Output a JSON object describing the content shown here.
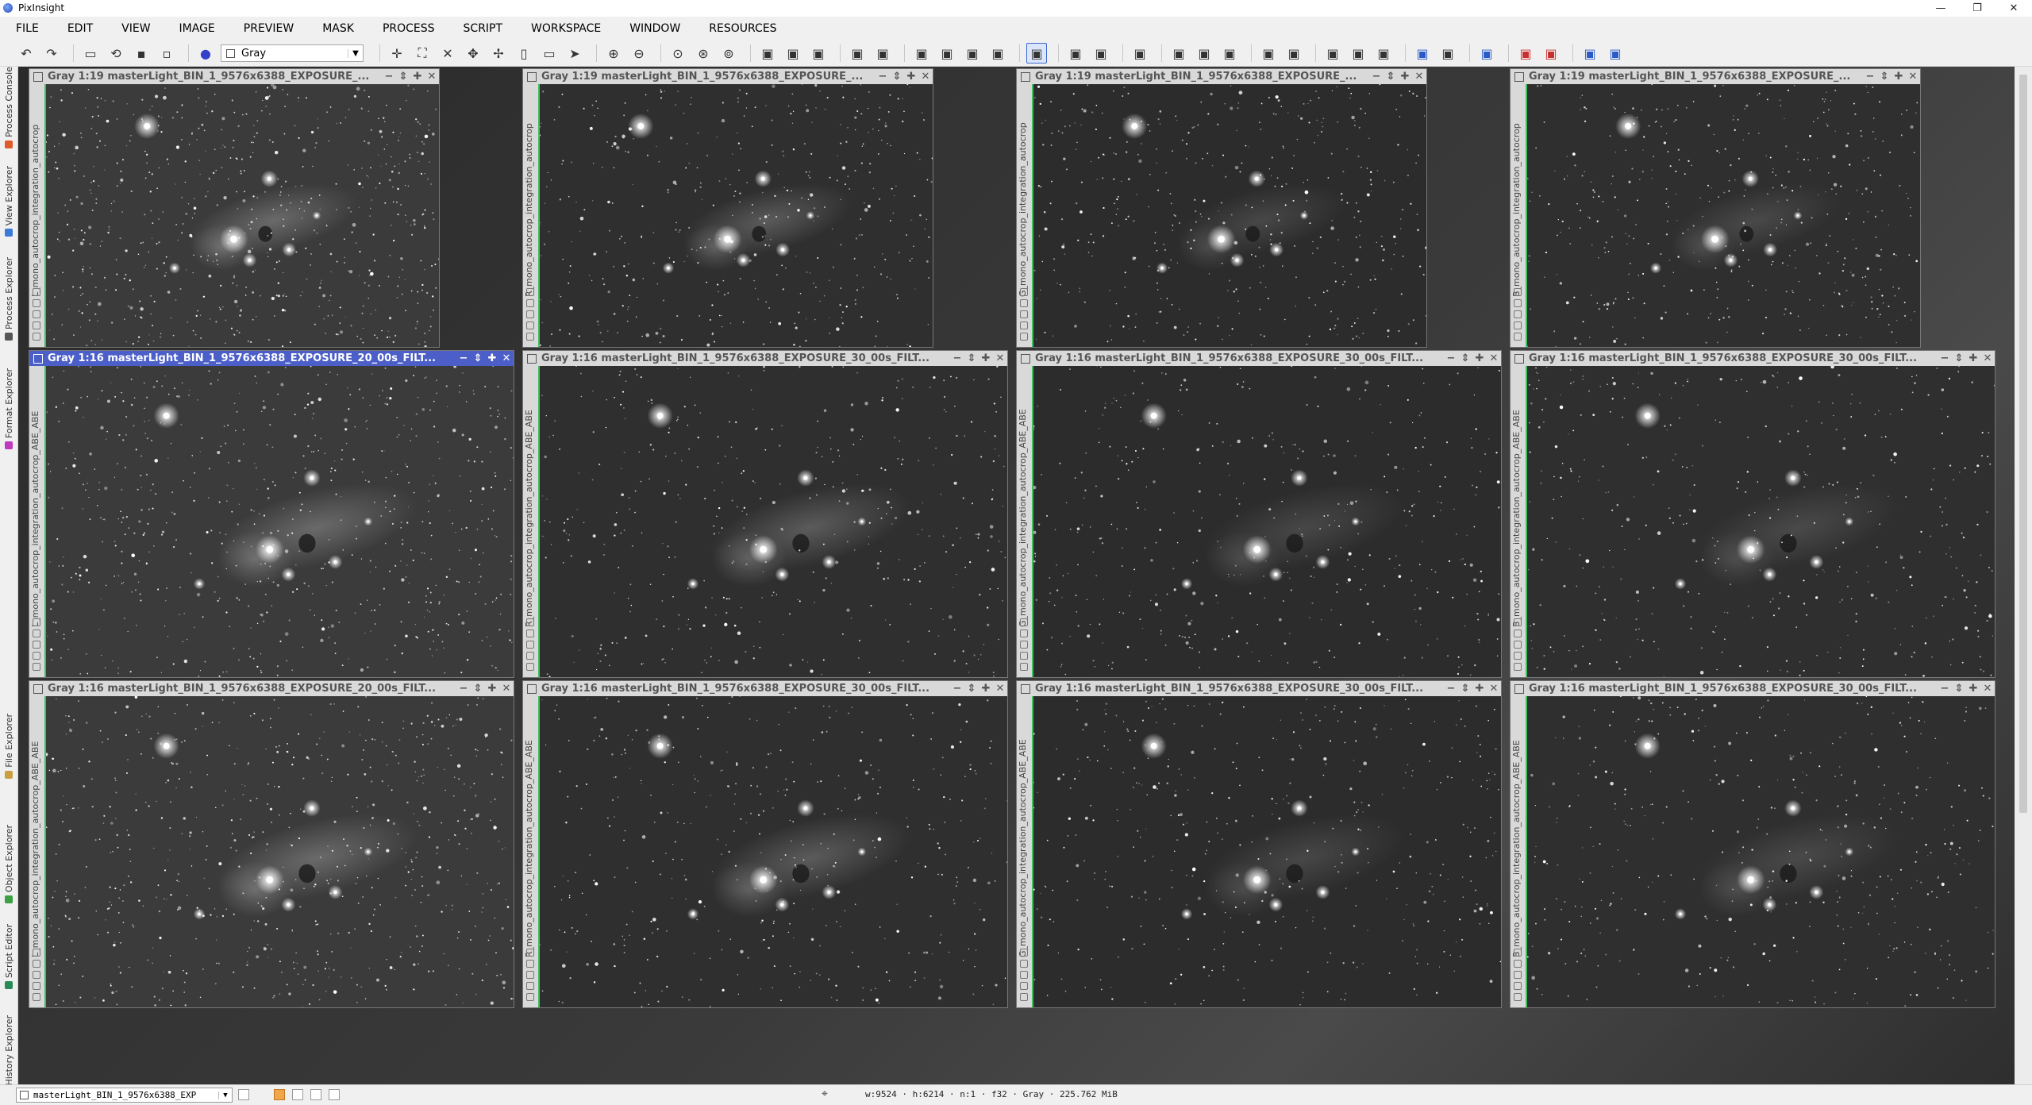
{
  "app": {
    "title": "PixInsight"
  },
  "window_controls": {
    "minimize": "—",
    "restore": "❐",
    "close": "✕"
  },
  "menu": [
    "FILE",
    "EDIT",
    "VIEW",
    "IMAGE",
    "PREVIEW",
    "MASK",
    "PROCESS",
    "SCRIPT",
    "WORKSPACE",
    "WINDOW",
    "RESOURCES"
  ],
  "toolbar": {
    "view_select": "Gray",
    "buttons": [
      "undo-icon",
      "redo-icon",
      "sep",
      "open-icon",
      "reopen-icon",
      "save-icon",
      "save-as-icon",
      "sep",
      "color-space-icon",
      "select",
      "sep",
      "readout-icon",
      "zoom-fit-icon",
      "fit-view-icon",
      "pan-icon",
      "move-icon",
      "edit-preview-icon",
      "rect-icon",
      "pointer-icon",
      "sep",
      "zoom-in-icon",
      "zoom-out-icon",
      "sep",
      "zoom-1-icon",
      "zoom-2-icon",
      "zoom-3-icon",
      "sep",
      "preview-new-icon",
      "preview-edit-icon",
      "preview-del-icon",
      "sep",
      "layout-1-icon",
      "layout-2-icon",
      "sep",
      "mask-1-icon",
      "mask-2-icon",
      "mask-3-icon",
      "mask-4-icon",
      "sep",
      "stf-icon",
      "sep",
      "stf-1-icon",
      "stf-2-icon",
      "sep",
      "track-icon",
      "sep",
      "hist-1-icon",
      "hist-2-icon",
      "hist-3-icon",
      "sep",
      "panel-1-icon",
      "panel-2-icon",
      "sep",
      "script-1-icon",
      "script-2-icon",
      "script-3-icon",
      "sep",
      "monitor-icon",
      "screenshot-icon",
      "sep",
      "export-icon",
      "sep",
      "red-1-icon",
      "red-2-icon",
      "sep",
      "blue-1-icon",
      "blue-2-icon"
    ]
  },
  "left_dock": [
    {
      "label": "Process Console",
      "icon_color": "#e05a2a"
    },
    {
      "label": "View Explorer",
      "icon_color": "#3a7ad8"
    },
    {
      "label": "Process Explorer",
      "icon_color": "#555555"
    },
    {
      "label": "Format Explorer",
      "icon_color": "#c03ac0"
    },
    {
      "label": "File Explorer",
      "icon_color": "#c8a040"
    },
    {
      "label": "Object Explorer",
      "icon_color": "#3aa040"
    },
    {
      "label": "Script Editor",
      "icon_color": "#2a8a5a"
    },
    {
      "label": "History Explorer",
      "icon_color": "#e07a2a"
    }
  ],
  "image_windows": [
    {
      "title": "Gray 1:19 masterLight_BIN_1_9576x6388_EXPOSURE_...",
      "id": "L_mono_autocrop_integration_autocrop",
      "active": false
    },
    {
      "title": "Gray 1:19 masterLight_BIN_1_9576x6388_EXPOSURE_...",
      "id": "R_mono_autocrop_integration_autocrop",
      "active": false
    },
    {
      "title": "Gray 1:19 masterLight_BIN_1_9576x6388_EXPOSURE_...",
      "id": "G_mono_autocrop_integration_autocrop",
      "active": false
    },
    {
      "title": "Gray 1:19 masterLight_BIN_1_9576x6388_EXPOSURE_...",
      "id": "B_mono_autocrop_integration_autocrop",
      "active": false
    },
    {
      "title": "Gray 1:16 masterLight_BIN_1_9576x6388_EXPOSURE_20_00s_FILT...",
      "id": "L_mono_autocrop_integration_autocrop_ABE_ABE",
      "active": true
    },
    {
      "title": "Gray 1:16 masterLight_BIN_1_9576x6388_EXPOSURE_30_00s_FILT...",
      "id": "R_mono_autocrop_integration_autocrop_ABE_ABE",
      "active": false
    },
    {
      "title": "Gray 1:16 masterLight_BIN_1_9576x6388_EXPOSURE_30_00s_FILT...",
      "id": "G_mono_autocrop_integration_autocrop_ABE_ABE",
      "active": false
    },
    {
      "title": "Gray 1:16 masterLight_BIN_1_9576x6388_EXPOSURE_30_00s_FILT...",
      "id": "B_mono_autocrop_integration_autocrop_ABE_ABE",
      "active": false
    },
    {
      "title": "Gray 1:16 masterLight_BIN_1_9576x6388_EXPOSURE_20_00s_FILT...",
      "id": "L_mono_autocrop_integration_autocrop_ABE_ABE",
      "active": false
    },
    {
      "title": "Gray 1:16 masterLight_BIN_1_9576x6388_EXPOSURE_30_00s_FILT...",
      "id": "R_mono_autocrop_integration_autocrop_ABE_ABE",
      "active": false
    },
    {
      "title": "Gray 1:16 masterLight_BIN_1_9576x6388_EXPOSURE_30_00s_FILT...",
      "id": "G_mono_autocrop_integration_autocrop_ABE_ABE",
      "active": false
    },
    {
      "title": "Gray 1:16 masterLight_BIN_1_9576x6388_EXPOSURE_30_00s_FILT...",
      "id": "B_mono_autocrop_integration_autocrop_ABE_ABE",
      "active": false
    }
  ],
  "status": {
    "view_select": "masterLight_BIN_1_9576x6388_EXP",
    "info": "w:9524 · h:6214 · n:1 · f32 · Gray · 225.762 MiB"
  }
}
